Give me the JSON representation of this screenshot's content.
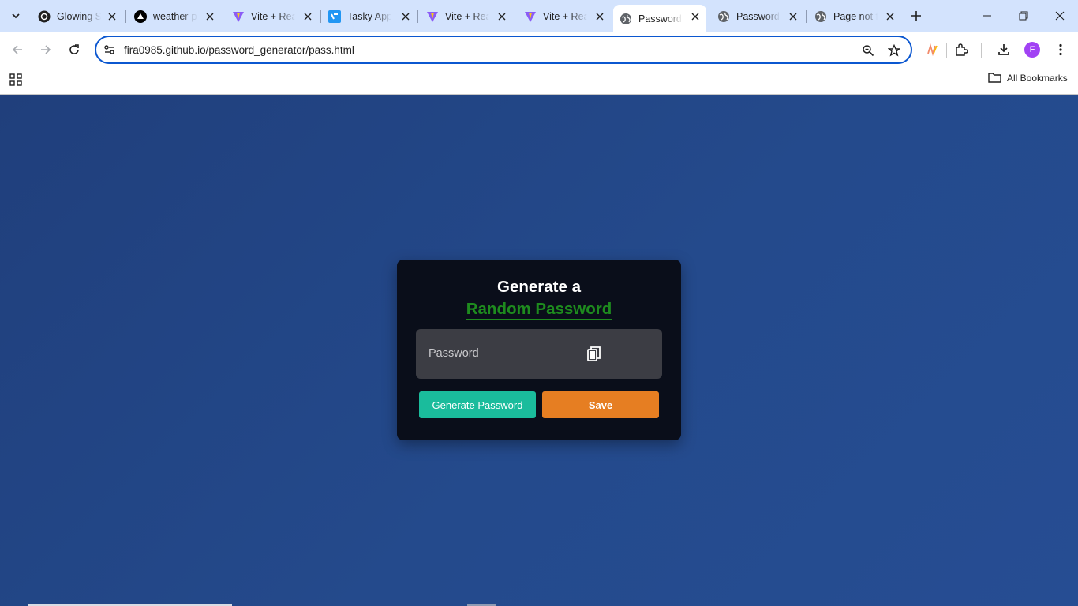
{
  "browser": {
    "tabs": [
      {
        "title": "Glowing Social",
        "icon": "threads-icon",
        "active": false
      },
      {
        "title": "weather-pwa",
        "icon": "vercel-icon",
        "active": false
      },
      {
        "title": "Vite + React",
        "icon": "vite-icon",
        "active": false
      },
      {
        "title": "Tasky App",
        "icon": "tasky-icon",
        "active": false
      },
      {
        "title": "Vite + React",
        "icon": "vite-icon",
        "active": false
      },
      {
        "title": "Vite + React",
        "icon": "vite-icon",
        "active": false
      },
      {
        "title": "Password Generator",
        "icon": "globe-icon",
        "active": true
      },
      {
        "title": "Password Generator",
        "icon": "globe-icon",
        "active": false
      },
      {
        "title": "Page not found",
        "icon": "globe-icon",
        "active": false
      }
    ],
    "url": "fira0985.github.io/password_generator/pass.html",
    "profile_initial": "F",
    "all_bookmarks_label": "All Bookmarks",
    "accent_color": "#0b57d0"
  },
  "app": {
    "heading_line1": "Generate a",
    "heading_line2": "Random Password",
    "password_placeholder": "Password",
    "password_value": "",
    "generate_button": "Generate Password",
    "save_button": "Save",
    "colors": {
      "card_bg": "#0a0e1a",
      "heading_accent": "#1e8b1e",
      "generate_bg": "#1abc9c",
      "save_bg": "#e67e22",
      "page_bg": "#234688"
    }
  }
}
